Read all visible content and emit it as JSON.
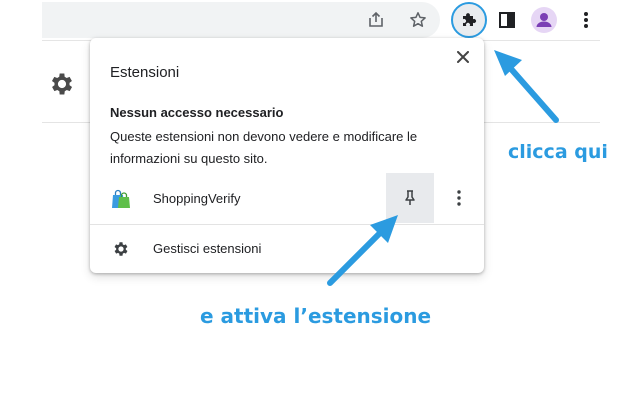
{
  "toolbar": {
    "icons": [
      "share-icon",
      "star-icon",
      "extensions-puzzle-icon",
      "side-panel-icon",
      "profile-avatar-icon",
      "kebab-menu-icon"
    ],
    "accent_color": "#2b9be0",
    "avatar_color": "#7b3fb5"
  },
  "popup": {
    "title": "Estensioni",
    "section_heading": "Nessun accesso necessario",
    "section_description": "Queste estensioni non devono vedere e modificare le informazioni su questo sito.",
    "extension": {
      "name": "ShoppingVerify",
      "pinned": false
    },
    "manage_label": "Gestisci estensioni"
  },
  "annotations": {
    "click_here": "clicca qui",
    "activate_extension": "e attiva l’estensione",
    "color": "#2b9be0"
  }
}
